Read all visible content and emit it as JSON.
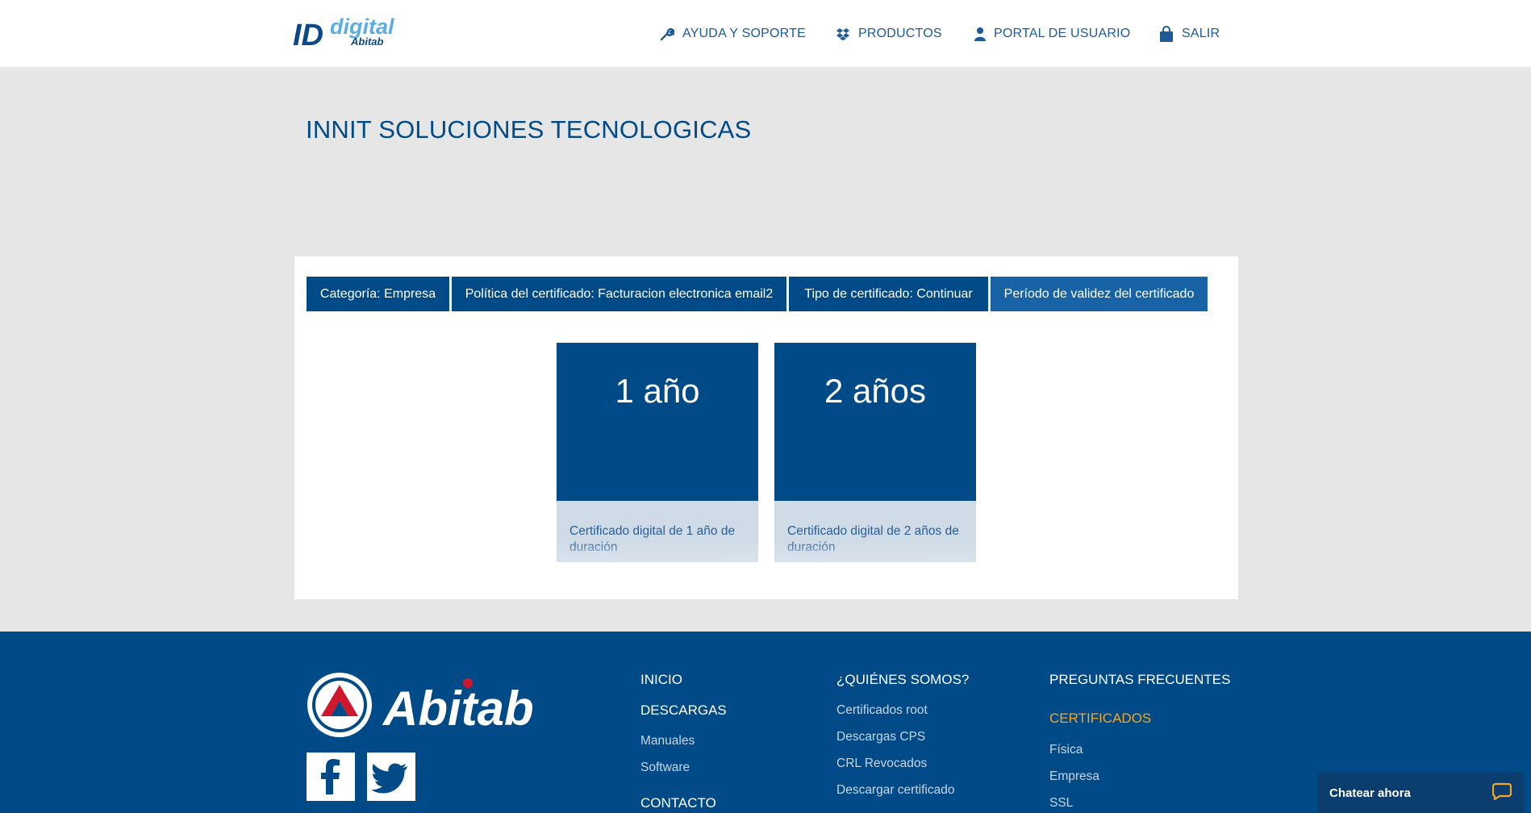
{
  "header": {
    "logo": {
      "id_text": "ID",
      "digital_text": "digital",
      "brand_text": "Abitab"
    },
    "nav": {
      "ayuda": "AYUDA Y SOPORTE",
      "productos": "PRODUCTOS",
      "portal": "PORTAL DE USUARIO",
      "salir": "SALIR"
    }
  },
  "page": {
    "title": "INNIT SOLUCIONES TECNOLOGICAS"
  },
  "steps": [
    {
      "label": "Categoría: Empresa"
    },
    {
      "label": "Política del certificado: Facturacion electronica email2"
    },
    {
      "label": "Tipo de certificado: Continuar"
    },
    {
      "label": "Período de validez del certificado"
    }
  ],
  "options": [
    {
      "title": "1 año",
      "description": "Certificado digital de 1 año de duración"
    },
    {
      "title": "2 años",
      "description": "Certificado digital de 2 años de duración"
    }
  ],
  "footer": {
    "brand": "Abitab",
    "col1": {
      "inicio": "INICIO",
      "descargas": "DESCARGAS",
      "manuales": "Manuales",
      "software": "Software",
      "contacto": "CONTACTO"
    },
    "col2": {
      "quienes": "¿QUIÉNES SOMOS?",
      "certificados_root": "Certificados root",
      "descargas_cps": "Descargas CPS",
      "crl": "CRL Revocados",
      "descargar_cert": "Descargar certificado"
    },
    "col3": {
      "preguntas": "PREGUNTAS FRECUENTES",
      "certificados": "CERTIFICADOS",
      "fisica": "Física",
      "empresa": "Empresa",
      "ssl": "SSL"
    }
  },
  "chat": {
    "label": "Chatear ahora"
  },
  "colors": {
    "primary": "#004a87",
    "active_step": "#1763a6",
    "accent": "#f5a623",
    "background": "#e6e6e6"
  }
}
